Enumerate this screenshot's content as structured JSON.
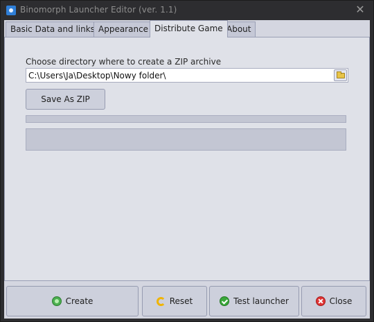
{
  "window": {
    "title": "Binomorph Launcher Editor (ver. 1.1)",
    "close_glyph": "✕"
  },
  "tabs": [
    {
      "label": "Basic Data and links",
      "active": false
    },
    {
      "label": "Appearance",
      "active": false
    },
    {
      "label": "Distribute Game",
      "active": true
    },
    {
      "label": "About",
      "active": false
    }
  ],
  "distribute": {
    "directory_label": "Choose directory where to create a ZIP archive",
    "directory_value": "C:\\Users\\Ja\\Desktop\\Nowy folder\\",
    "browse_icon": "folder-icon",
    "save_zip_label": "Save As ZIP",
    "progress_percent": 0,
    "status_text": ""
  },
  "footer": {
    "create_label": "Create",
    "reset_label": "Reset",
    "test_label": "Test launcher",
    "close_label": "Close"
  },
  "colors": {
    "client_bg": "#d4d6e0",
    "panel_bg": "#dfe1e8",
    "titlebar_bg": "#2d2d30",
    "progress_fill": "#5b8be0"
  }
}
